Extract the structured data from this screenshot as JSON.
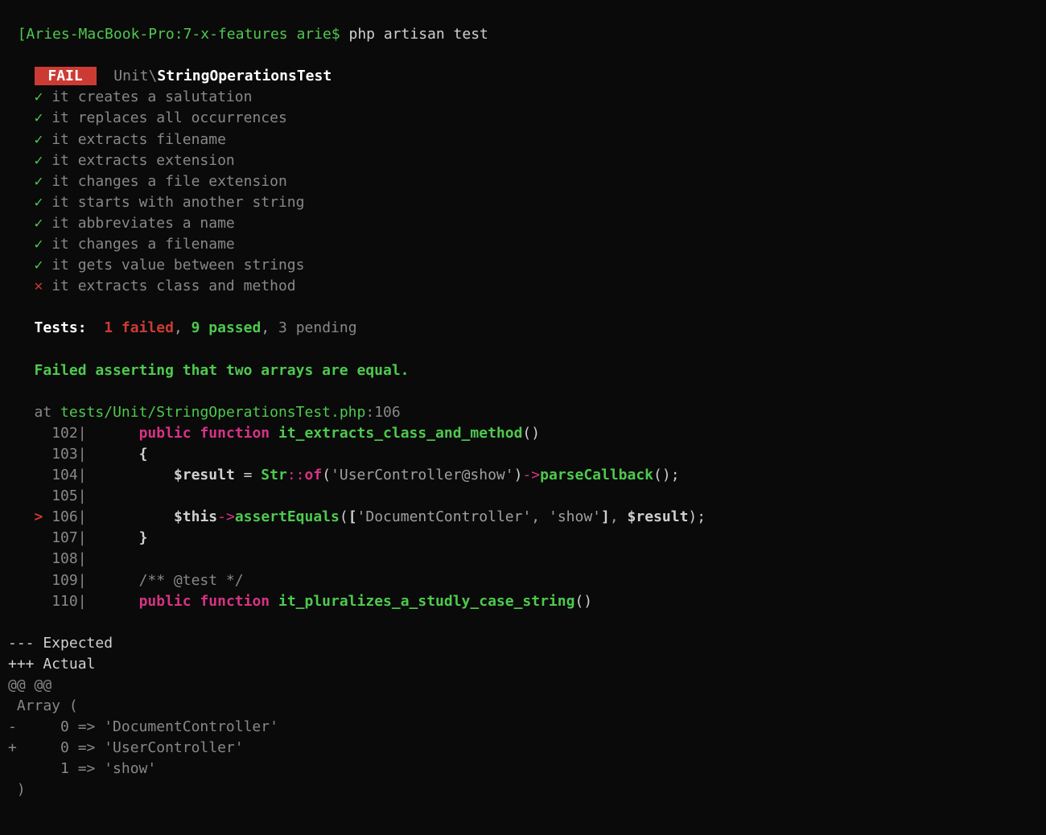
{
  "prompt": {
    "host": "[Aries-MacBook-Pro:7-x-features arie$ ",
    "command": "php artisan test"
  },
  "fail_badge": " FAIL ",
  "suite_prefix": "Unit\\",
  "suite_class": "StringOperationsTest",
  "tests": [
    {
      "icon": "✓",
      "name": "it creates a salutation",
      "status": "pass"
    },
    {
      "icon": "✓",
      "name": "it replaces all occurrences",
      "status": "pass"
    },
    {
      "icon": "✓",
      "name": "it extracts filename",
      "status": "pass"
    },
    {
      "icon": "✓",
      "name": "it extracts extension",
      "status": "pass"
    },
    {
      "icon": "✓",
      "name": "it changes a file extension",
      "status": "pass"
    },
    {
      "icon": "✓",
      "name": "it starts with another string",
      "status": "pass"
    },
    {
      "icon": "✓",
      "name": "it abbreviates a name",
      "status": "pass"
    },
    {
      "icon": "✓",
      "name": "it changes a filename",
      "status": "pass"
    },
    {
      "icon": "✓",
      "name": "it gets value between strings",
      "status": "pass"
    },
    {
      "icon": "✕",
      "name": "it extracts class and method",
      "status": "fail"
    }
  ],
  "summary": {
    "label": "Tests:",
    "failed": "1 failed",
    "passed": "9 passed",
    "pending": "3 pending"
  },
  "error_message": "Failed asserting that two arrays are equal.",
  "location": {
    "at": "at",
    "path": "tests/Unit/StringOperationsTest.php",
    "line": "106"
  },
  "code": {
    "l102": "102",
    "l103": "103",
    "l104": "104",
    "l105": "105",
    "l106": "106",
    "l107": "107",
    "l108": "108",
    "l109": "109",
    "l110": "110",
    "kw_public": "public",
    "kw_function": "function",
    "fn1": "it_extracts_class_and_method",
    "fn2": "it_pluralizes_a_studly_case_string",
    "var_result": "$result",
    "var_this": "$this",
    "cls_str": "Str",
    "of_method": "of",
    "parse_cb": "parseCallback",
    "assert_eq": "assertEquals",
    "str1": "'UserController@show'",
    "str_doc": "'DocumentController'",
    "str_show": "'show'",
    "comment": "/** @test */"
  },
  "diff": {
    "expected": "--- Expected",
    "actual": "+++ Actual",
    "hunk": "@@ @@",
    "array_open": " Array (",
    "minus": "-     0 => 'DocumentController'",
    "plus": "+     0 => 'UserController'",
    "same": "      1 => 'show'",
    "close": " )"
  }
}
